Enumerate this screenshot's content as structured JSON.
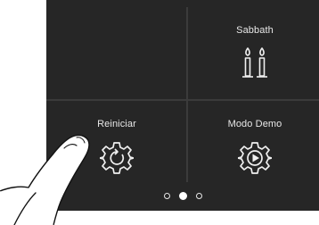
{
  "tiles": [
    {
      "label": "",
      "icon": "empty"
    },
    {
      "label": "Sabbath",
      "icon": "candles-icon"
    },
    {
      "label": "Reiniciar",
      "icon": "gear-reset-icon"
    },
    {
      "label": "Modo Demo",
      "icon": "gear-play-icon"
    }
  ],
  "pagination": {
    "pages": 3,
    "current_page": 2
  },
  "colors": {
    "screen_background": "#262626",
    "divider": "#3b3b3b",
    "text": "#e8e8e8"
  }
}
